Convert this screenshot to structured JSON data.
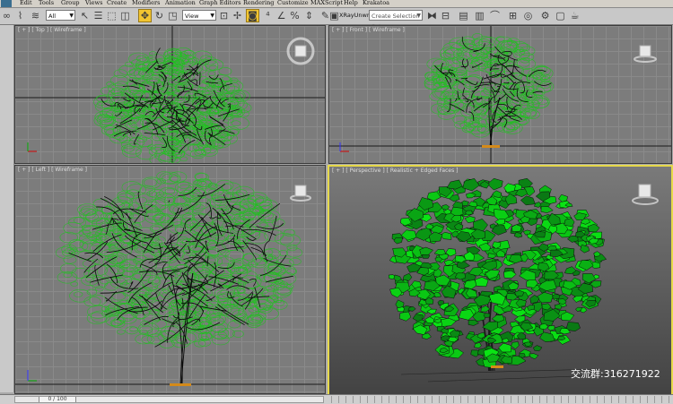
{
  "menubar": {
    "items": [
      "Edit",
      "Tools",
      "Group",
      "Views",
      "Create",
      "Modifiers",
      "Animation",
      "Graph Editors",
      "Rendering",
      "Customize",
      "MAXScript",
      "Help",
      "Krakatoa"
    ]
  },
  "toolbar": {
    "selection_filter": "All",
    "reference_coord": "View",
    "xray_label": "XRayUnwrap",
    "named_selection_placeholder": "Create Selection Set"
  },
  "viewports": {
    "top": {
      "label": "[ + ] [ Top ] [ Wireframe ]"
    },
    "front": {
      "label": "[ + ] [ Front ] [ Wireframe ]"
    },
    "left": {
      "label": "[ + ] [ Left ] [ Wireframe ]"
    },
    "perspective": {
      "label": "[ + ] [ Perspective ] [ Realistic + Edged Faces ]"
    }
  },
  "time_slider": {
    "frame": "0 / 100"
  },
  "watermark": {
    "text": "交流群:316271922"
  },
  "colors": {
    "foliage": "#1fc21f",
    "branches": "#0a0a0a",
    "active_viewport_border": "#e6d94a",
    "selected_tool": "#f2c531"
  }
}
